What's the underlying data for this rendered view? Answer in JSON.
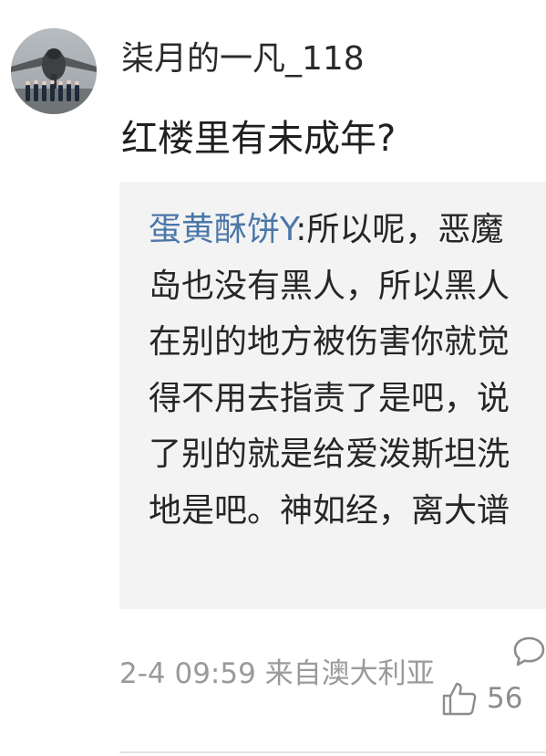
{
  "comment": {
    "username": "柒月的一凡_118",
    "text": "红楼里有未成年?",
    "avatar_icon": "avatar-cargo-plane-crew",
    "quote": {
      "author": "蛋黄酥饼Y",
      "separator": ":",
      "text": "所以呢，恶魔岛也没有黑人，所以黑人在别的地方被伤害你就觉得不用去指责了是吧，说了别的就是给爱泼斯坦洗地是吧。神如经，离大谱"
    },
    "meta": "2-4 09:59 来自澳大利亚",
    "likes": "56",
    "icons": {
      "reply": "comment-bubble-icon",
      "like": "thumbs-up-icon"
    },
    "colors": {
      "author_link": "#4b77a8",
      "quote_background": "#f3f3f3",
      "meta_text": "#9a9a9a"
    }
  }
}
